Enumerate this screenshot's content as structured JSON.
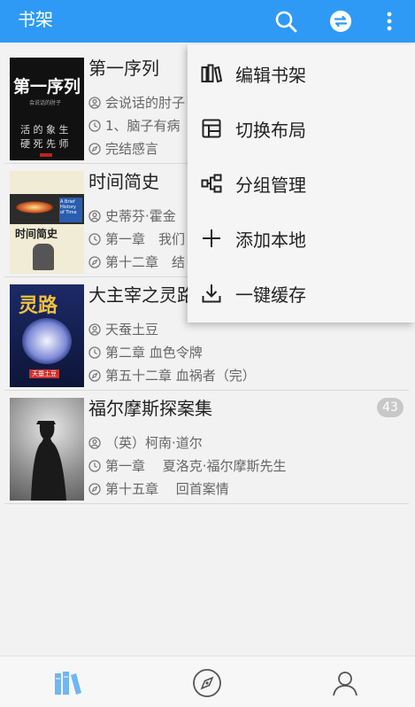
{
  "header": {
    "title": "书架"
  },
  "books": [
    {
      "name": "第一序列",
      "author": "会说话的肘子",
      "latest": "1、脑子有病",
      "read": "完结感言",
      "cover_title": "第一序列",
      "cover_sub": "会说话的肘子",
      "cover_text": "活 的 象 生 硬 死 先 师"
    },
    {
      "name": "时间简史",
      "author": "史蒂芬·霍金",
      "latest": "第一章　我们",
      "read": "第十二章　结",
      "cover_title": "时间简史",
      "cover_side": "A Brief History of Time"
    },
    {
      "name": "大主宰之灵路",
      "author": "天蚕土豆",
      "latest": "第二章 血色令牌",
      "read": "第五十二章 血祸者（完）",
      "cover_title": "灵路",
      "cover_sub": "天蚕土豆"
    },
    {
      "name": "福尔摩斯探案集",
      "author": "（英）柯南·道尔",
      "latest": "第一章　 夏洛克·福尔摩斯先生",
      "read": "第十五章　 回首案情",
      "badge": "43"
    }
  ],
  "menu": {
    "items": [
      {
        "label": "编辑书架",
        "icon": "edit-bookshelf-icon"
      },
      {
        "label": "切换布局",
        "icon": "layout-icon"
      },
      {
        "label": "分组管理",
        "icon": "group-icon"
      },
      {
        "label": "添加本地",
        "icon": "plus-icon"
      },
      {
        "label": "一键缓存",
        "icon": "download-icon"
      }
    ]
  },
  "colors": {
    "primary": "#2f9af5",
    "menu_bg": "#f5f5f5",
    "text": "#222222",
    "muted": "#666666"
  }
}
